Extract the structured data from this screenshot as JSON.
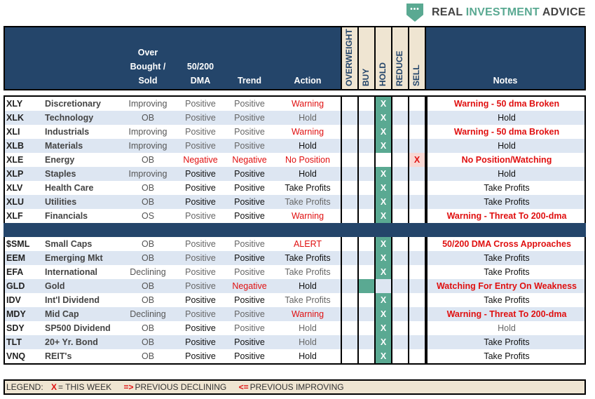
{
  "brand": {
    "logo_dots": "•••",
    "word1": "REAL",
    "word2": "INVESTMENT",
    "word3": "ADVICE"
  },
  "header": {
    "ob_line1": "Over",
    "ob_line2": "Bought /",
    "ob_line3": "Sold",
    "dma_line1": "50/200",
    "dma_line2": "DMA",
    "trend": "Trend",
    "action": "Action",
    "overweight": "OVERWEIGHT",
    "buy": "BUY",
    "hold": "HOLD",
    "reduce": "REDUCE",
    "sell": "SELL",
    "notes": "Notes"
  },
  "sectors": [
    {
      "ticker": "XLY",
      "name": "Discretionary",
      "ob": "Improving",
      "dma": "Positive",
      "dma_c": "gray",
      "trend": "Positive",
      "trend_c": "gray",
      "action": "Warning",
      "action_c": "red",
      "pos": "hold",
      "notes": "Warning - 50 dma Broken",
      "notes_c": "red"
    },
    {
      "ticker": "XLK",
      "name": "Technology",
      "ob": "OB",
      "dma": "Positive",
      "dma_c": "gray",
      "trend": "Positive",
      "trend_c": "gray",
      "action": "Hold",
      "action_c": "gray",
      "pos": "hold",
      "notes": "Hold",
      "notes_c": "black"
    },
    {
      "ticker": "XLI",
      "name": "Industrials",
      "ob": "Improving",
      "dma": "Positive",
      "dma_c": "gray",
      "trend": "Positive",
      "trend_c": "gray",
      "action": "Warning",
      "action_c": "red",
      "pos": "hold",
      "notes": "Warning - 50 dma Broken",
      "notes_c": "red"
    },
    {
      "ticker": "XLB",
      "name": "Materials",
      "ob": "Improving",
      "dma": "Positive",
      "dma_c": "gray",
      "trend": "Positive",
      "trend_c": "gray",
      "action": "Hold",
      "action_c": "black",
      "pos": "hold",
      "notes": "Hold",
      "notes_c": "black"
    },
    {
      "ticker": "XLE",
      "name": "Energy",
      "ob": "OB",
      "dma": "Negative",
      "dma_c": "red",
      "trend": "Negative",
      "trend_c": "red",
      "action": "No Position",
      "action_c": "red",
      "pos": "sell",
      "notes": "No Position/Watching",
      "notes_c": "red"
    },
    {
      "ticker": "XLP",
      "name": "Staples",
      "ob": "Improving",
      "dma": "Positive",
      "dma_c": "black",
      "trend": "Positive",
      "trend_c": "black",
      "action": "Hold",
      "action_c": "black",
      "pos": "hold",
      "notes": "Hold",
      "notes_c": "black"
    },
    {
      "ticker": "XLV",
      "name": "Health Care",
      "ob": "OB",
      "dma": "Positive",
      "dma_c": "black",
      "trend": "Positive",
      "trend_c": "black",
      "action": "Take Profits",
      "action_c": "black",
      "pos": "hold",
      "notes": "Take Profits",
      "notes_c": "black"
    },
    {
      "ticker": "XLU",
      "name": "Utilities",
      "ob": "OB",
      "dma": "Positive",
      "dma_c": "black",
      "trend": "Positive",
      "trend_c": "black",
      "action": "Take Profits",
      "action_c": "gray",
      "pos": "hold",
      "notes": "Take Profits",
      "notes_c": "black"
    },
    {
      "ticker": "XLF",
      "name": "Financials",
      "ob": "OS",
      "dma": "Positive",
      "dma_c": "gray",
      "trend": "Positive",
      "trend_c": "black",
      "action": "Warning",
      "action_c": "red",
      "pos": "hold",
      "notes": "Warning - Threat To 200-dma",
      "notes_c": "red"
    }
  ],
  "markets": [
    {
      "ticker": "$SML",
      "name": "Small Caps",
      "ob": "OB",
      "dma": "Positive",
      "dma_c": "gray",
      "trend": "Positive",
      "trend_c": "gray",
      "action": "ALERT",
      "action_c": "red",
      "pos": "hold",
      "notes": "50/200 DMA Cross Approaches",
      "notes_c": "red"
    },
    {
      "ticker": "EEM",
      "name": "Emerging Mkt",
      "ob": "OB",
      "dma": "Positive",
      "dma_c": "gray",
      "trend": "Positive",
      "trend_c": "black",
      "action": "Take Profits",
      "action_c": "black",
      "pos": "hold",
      "notes": "Take Profits",
      "notes_c": "black"
    },
    {
      "ticker": "EFA",
      "name": "International",
      "ob": "Declining",
      "dma": "Positive",
      "dma_c": "gray",
      "trend": "Positive",
      "trend_c": "gray",
      "action": "Take Profits",
      "action_c": "gray",
      "pos": "hold",
      "notes": "Take Profits",
      "notes_c": "black"
    },
    {
      "ticker": "GLD",
      "name": "Gold",
      "ob": "OB",
      "dma": "Positive",
      "dma_c": "gray",
      "trend": "Negative",
      "trend_c": "red",
      "action": "Hold",
      "action_c": "black",
      "pos": "buy-empty",
      "notes": "Watching For Entry On Weakness",
      "notes_c": "red"
    },
    {
      "ticker": "IDV",
      "name": "Int'l Dividend",
      "ob": "OB",
      "dma": "Positive",
      "dma_c": "black",
      "trend": "Positive",
      "trend_c": "black",
      "action": "Take Profits",
      "action_c": "gray",
      "pos": "hold",
      "notes": "Take Profits",
      "notes_c": "black"
    },
    {
      "ticker": "MDY",
      "name": "Mid Cap",
      "ob": "Declining",
      "dma": "Positive",
      "dma_c": "gray",
      "trend": "Positive",
      "trend_c": "gray",
      "action": "Warning",
      "action_c": "red",
      "pos": "hold",
      "notes": "Warning - Threat To 200-dma",
      "notes_c": "red"
    },
    {
      "ticker": "SDY",
      "name": "SP500 Dividend",
      "ob": "OB",
      "dma": "Positive",
      "dma_c": "black",
      "trend": "Positive",
      "trend_c": "gray",
      "action": "Hold",
      "action_c": "gray",
      "pos": "hold",
      "notes": "Hold",
      "notes_c": "gray"
    },
    {
      "ticker": "TLT",
      "name": "20+ Yr. Bond",
      "ob": "OB",
      "dma": "Positive",
      "dma_c": "black",
      "trend": "Positive",
      "trend_c": "black",
      "action": "Hold",
      "action_c": "gray",
      "pos": "hold",
      "notes": "Take Profits",
      "notes_c": "black"
    },
    {
      "ticker": "VNQ",
      "name": "REIT's",
      "ob": "OB",
      "dma": "Positive",
      "dma_c": "black",
      "trend": "Positive",
      "trend_c": "black",
      "action": "Hold",
      "action_c": "black",
      "pos": "hold",
      "notes": "Take Profits",
      "notes_c": "black"
    }
  ],
  "mark": "X",
  "legend": {
    "label": "LEGEND:",
    "x": "X",
    "x_text": "= THIS WEEK",
    "arrow1": "=>",
    "arrow1_text": "PREVIOUS DECLINING",
    "arrow2": "<=",
    "arrow2_text": "PREVIOUS IMPROVING"
  }
}
